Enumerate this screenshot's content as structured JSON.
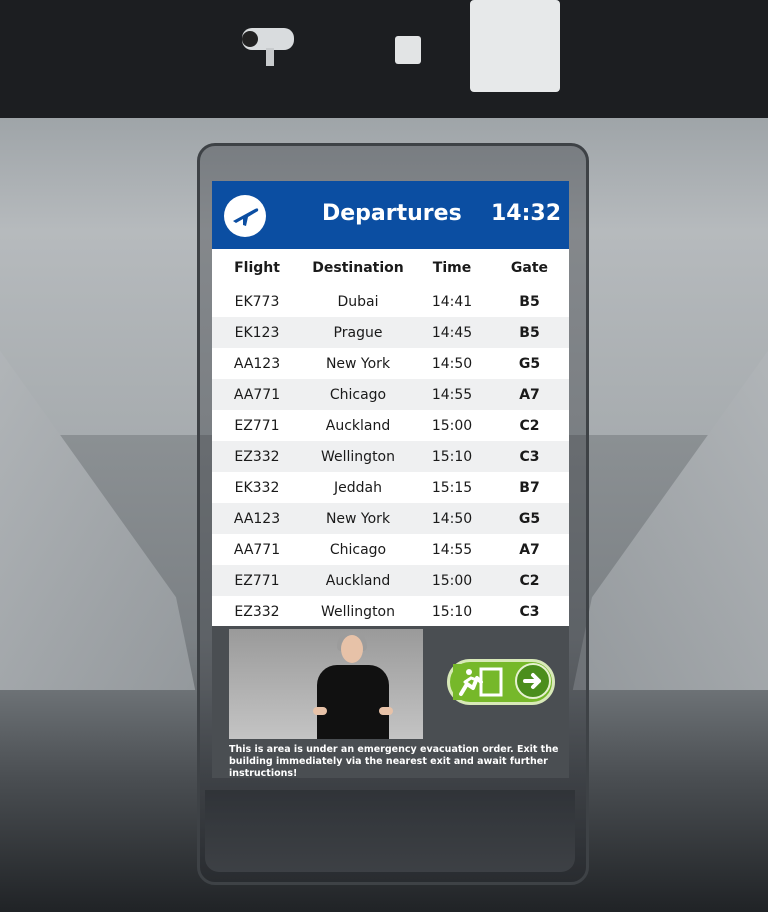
{
  "board": {
    "title": "Departures",
    "time": "14:32",
    "icon": "airplane-icon",
    "accent": "#0b4ea2"
  },
  "table": {
    "headers": [
      "Flight",
      "Destination",
      "Time",
      "Gate"
    ],
    "rows": [
      {
        "flight": "EK773",
        "destination": "Dubai",
        "time": "14:41",
        "gate": "B5"
      },
      {
        "flight": "EK123",
        "destination": "Prague",
        "time": "14:45",
        "gate": "B5"
      },
      {
        "flight": "AA123",
        "destination": "New York",
        "time": "14:50",
        "gate": "G5"
      },
      {
        "flight": "AA771",
        "destination": "Chicago",
        "time": "14:55",
        "gate": "A7"
      },
      {
        "flight": "EZ771",
        "destination": "Auckland",
        "time": "15:00",
        "gate": "C2"
      },
      {
        "flight": "EZ332",
        "destination": "Wellington",
        "time": "15:10",
        "gate": "C3"
      },
      {
        "flight": "EK332",
        "destination": "Jeddah",
        "time": "15:15",
        "gate": "B7"
      },
      {
        "flight": "AA123",
        "destination": "New York",
        "time": "14:50",
        "gate": "G5"
      },
      {
        "flight": "AA771",
        "destination": "Chicago",
        "time": "14:55",
        "gate": "A7"
      },
      {
        "flight": "EZ771",
        "destination": "Auckland",
        "time": "15:00",
        "gate": "C2"
      },
      {
        "flight": "EZ332",
        "destination": "Wellington",
        "time": "15:10",
        "gate": "C3"
      }
    ]
  },
  "alert": {
    "message": "This is area is under an emergency evacuation order. Exit the building immediately via the nearest exit and await further instructions!",
    "exit_icon": "emergency-exit-icon",
    "arrow_icon": "arrow-right-icon",
    "exit_color": "#76b82a"
  }
}
